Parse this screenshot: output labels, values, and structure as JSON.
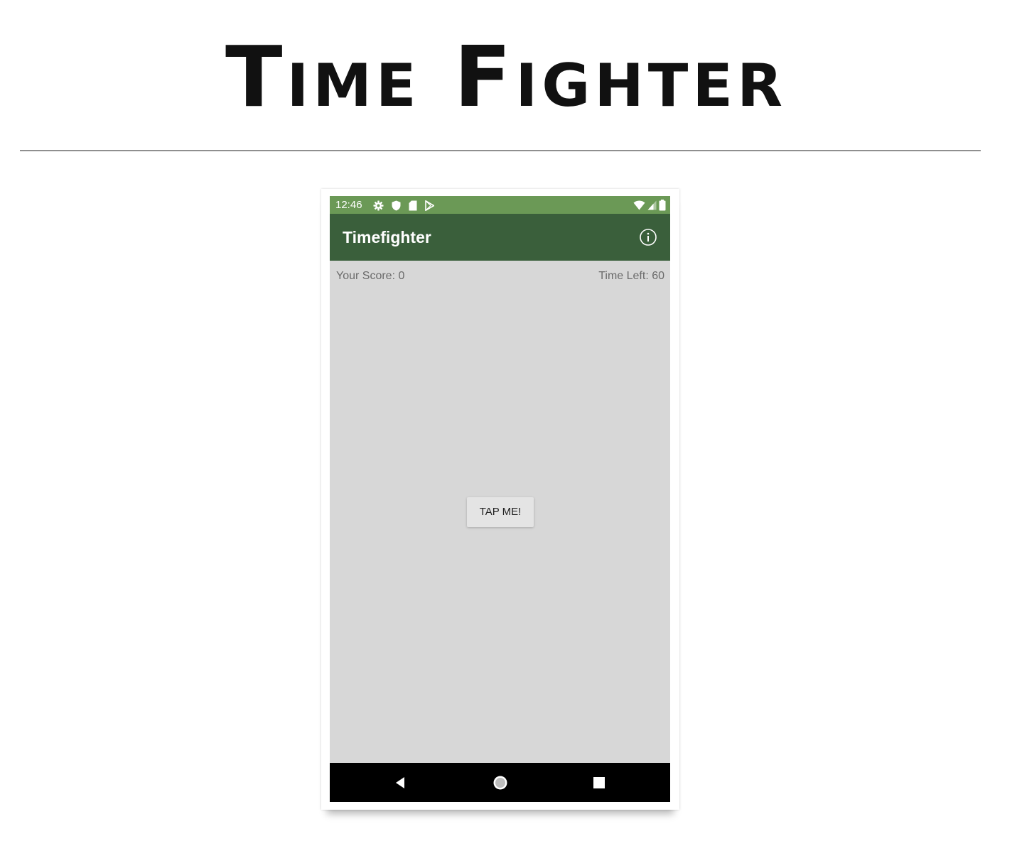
{
  "slide": {
    "title": "Time Fighter"
  },
  "phone": {
    "status_bar": {
      "time": "12:46",
      "left_icons": [
        "settings-icon",
        "shield-icon",
        "sd-card-icon",
        "play-store-icon"
      ],
      "right_icons": [
        "wifi-icon",
        "cellular-signal-icon",
        "battery-icon"
      ],
      "background_color": "#6b9956"
    },
    "app_bar": {
      "title": "Timefighter",
      "action_icon": "info-icon",
      "background_color": "#3a5f3b"
    },
    "score_label": "Your Score: 0",
    "time_left_label": "Time Left: 60",
    "tap_button_label": "TAP ME!",
    "content_background_color": "#d7d7d7",
    "nav_bar": {
      "icons": [
        "back-icon",
        "home-icon",
        "recents-icon"
      ]
    }
  }
}
